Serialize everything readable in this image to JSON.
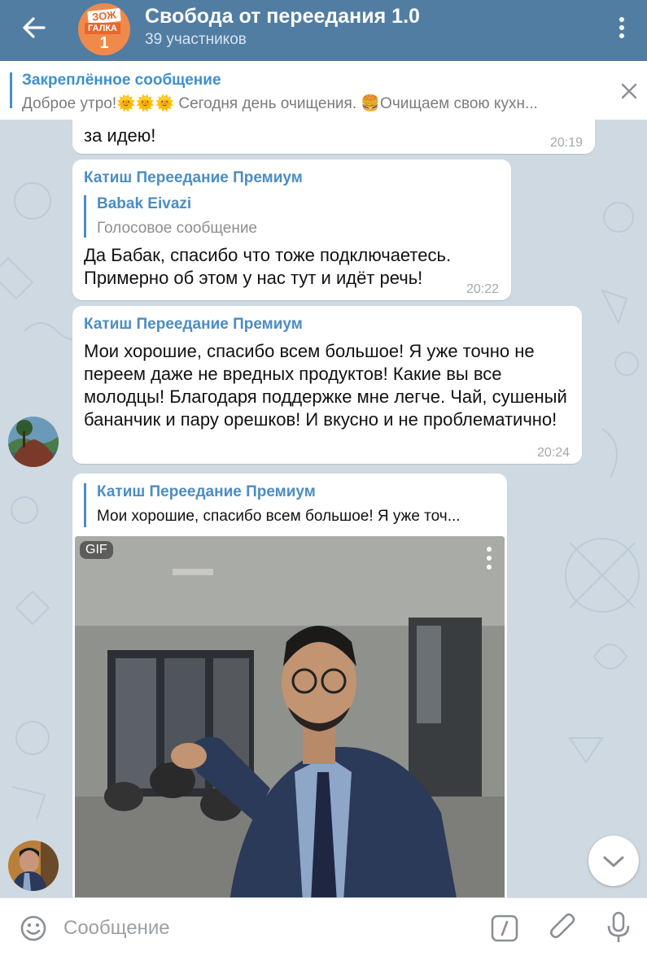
{
  "header": {
    "title": "Свобода от переедания 1.0",
    "subtitle": "39 участников",
    "avatar_line1": "ЗОЖ",
    "avatar_line2": "ГАЛКА",
    "avatar_line3": "1"
  },
  "pinned": {
    "title": "Закреплённое сообщение",
    "text": "Доброе утро!🌞🌞🌞  Сегодня день очищения.  🍔Очищаем свою кухн..."
  },
  "messages": [
    {
      "text": "за идею!",
      "time": "20:19"
    },
    {
      "sender": "Катиш Переедание Премиум",
      "reply_name": "Babak Eivazi",
      "reply_text": "Голосовое сообщение",
      "text": "Да Бабак, спасибо что тоже подключаетесь. Примерно об этом у нас тут и идёт речь!",
      "time": "20:22"
    },
    {
      "sender": "Катиш Переедание Премиум",
      "text": "Мои хорошие, спасибо всем большое! Я уже точно не переем даже не вредных продуктов! Какие вы все молодцы! Благодаря поддержке мне легче. Чай, сушеный бананчик и пару орешков! И вкусно и не проблематично!",
      "time": "20:24"
    },
    {
      "reply_name": "Катиш Переедание Премиум",
      "reply_text": "Мои хорошие, спасибо всем большое! Я уже точ...",
      "gif_label": "GIF"
    }
  ],
  "input": {
    "placeholder": "Сообщение"
  },
  "colors": {
    "header": "#517da2",
    "accent": "#4b8dc4",
    "background": "#cfd9e2"
  }
}
